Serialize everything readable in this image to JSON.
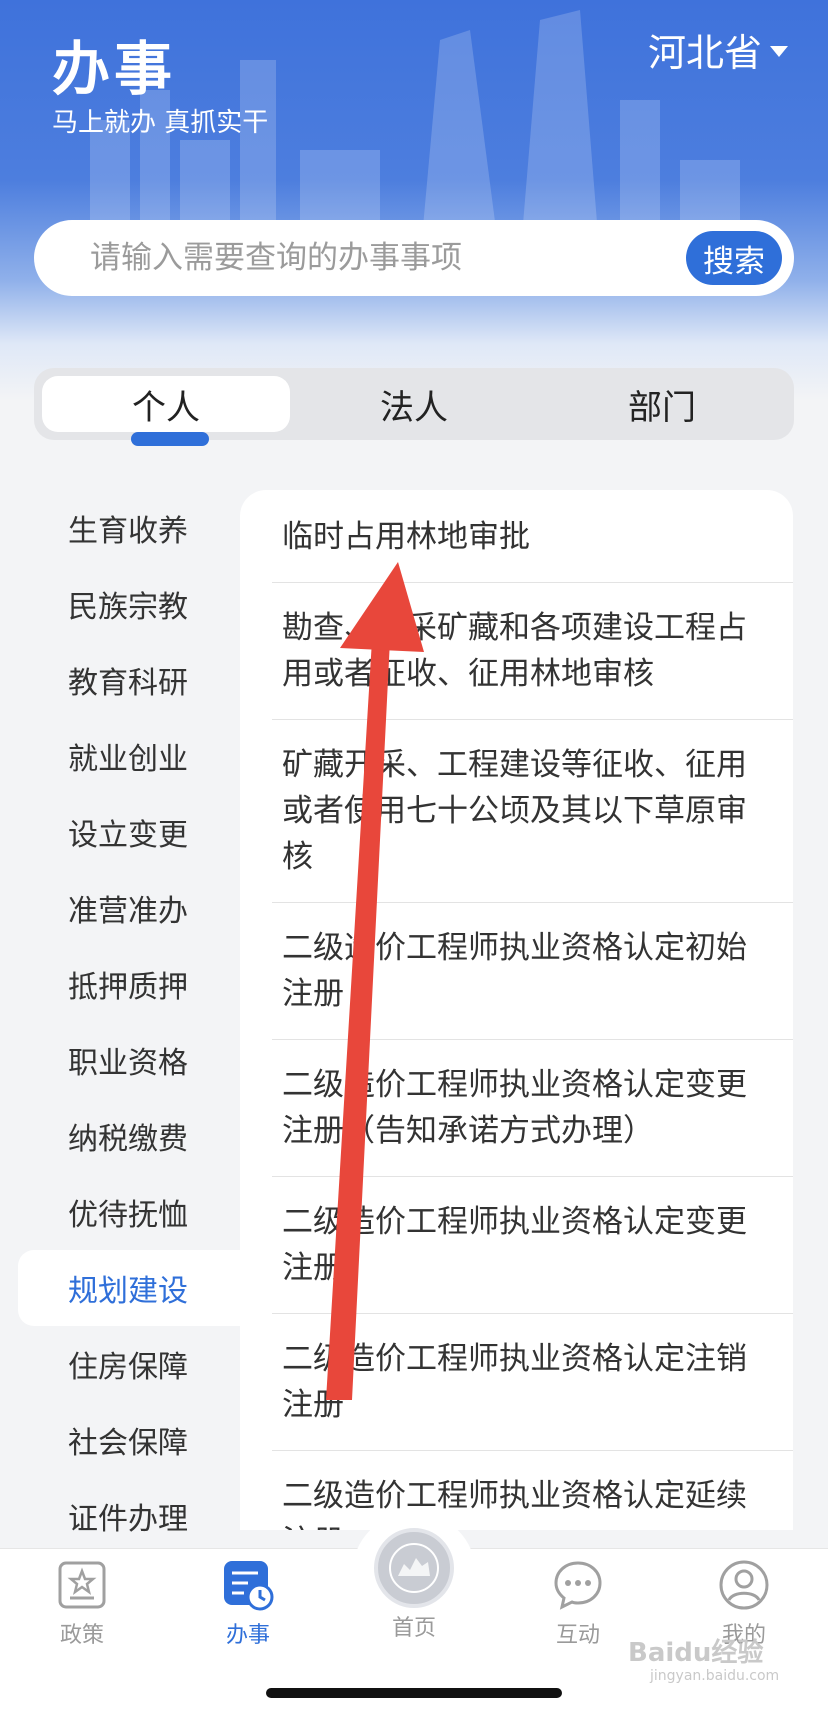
{
  "header": {
    "title": "办事",
    "subtitle": "马上就办   真抓实干",
    "province": "河北省"
  },
  "search": {
    "placeholder": "请输入需要查询的办事事项",
    "button_label": "搜索"
  },
  "tabs": [
    {
      "label": "个人",
      "active": true
    },
    {
      "label": "法人",
      "active": false
    },
    {
      "label": "部门",
      "active": false
    }
  ],
  "categories": [
    {
      "label": "生育收养"
    },
    {
      "label": "民族宗教"
    },
    {
      "label": "教育科研"
    },
    {
      "label": "就业创业"
    },
    {
      "label": "设立变更"
    },
    {
      "label": "准营准办"
    },
    {
      "label": "抵押质押"
    },
    {
      "label": "职业资格"
    },
    {
      "label": "纳税缴费"
    },
    {
      "label": "优待抚恤"
    },
    {
      "label": "规划建设",
      "active": true
    },
    {
      "label": "住房保障"
    },
    {
      "label": "社会保障"
    },
    {
      "label": "证件办理"
    }
  ],
  "items": [
    {
      "label": "临时占用林地审批"
    },
    {
      "label": "勘查、开采矿藏和各项建设工程占用或者征收、征用林地审核"
    },
    {
      "label": "矿藏开采、工程建设等征收、征用或者使用七十公顷及其以下草原审核"
    },
    {
      "label": "二级造价工程师执业资格认定初始注册"
    },
    {
      "label": "二级造价工程师执业资格认定变更注册（告知承诺方式办理）"
    },
    {
      "label": "二级造价工程师执业资格认定变更注册"
    },
    {
      "label": "二级造价工程师执业资格认定注销注册"
    },
    {
      "label": "二级造价工程师执业资格认定延续注册"
    }
  ],
  "bottom_nav": [
    {
      "label": "政策",
      "icon": "policy-icon"
    },
    {
      "label": "办事",
      "icon": "affairs-icon",
      "active": true
    },
    {
      "label": "首页",
      "icon": "home-emblem-icon"
    },
    {
      "label": "互动",
      "icon": "chat-icon"
    },
    {
      "label": "我的",
      "icon": "user-icon"
    }
  ],
  "watermark": {
    "text": "Baidu经验",
    "sub": "jingyan.baidu.com"
  },
  "colors": {
    "accent": "#2f6fd9",
    "annotation_arrow": "#e8473b"
  }
}
